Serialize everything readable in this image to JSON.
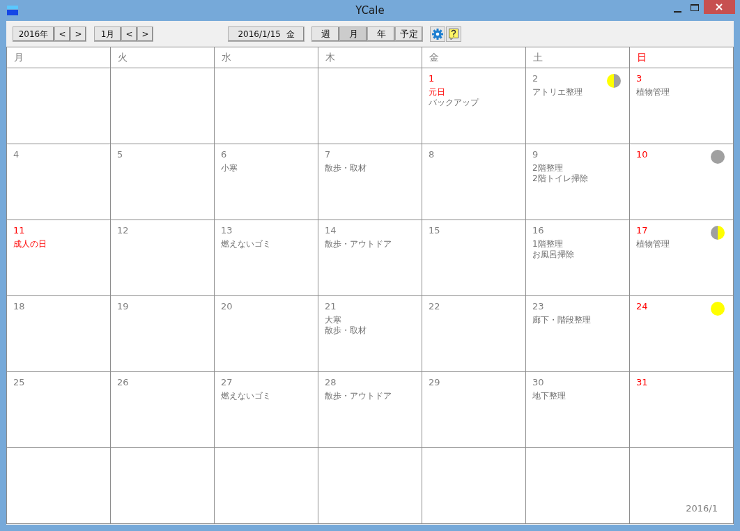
{
  "window": {
    "title": "YCale"
  },
  "toolbar": {
    "year": {
      "label": "2016年",
      "prev": "<",
      "next": ">"
    },
    "month": {
      "label": "1月",
      "prev": "<",
      "next": ">"
    },
    "today": "2016/1/15  金",
    "views": [
      {
        "label": "週",
        "selected": false
      },
      {
        "label": "月",
        "selected": true
      },
      {
        "label": "年",
        "selected": false
      },
      {
        "label": "予定",
        "selected": false
      }
    ]
  },
  "weekdays": [
    {
      "label": "月",
      "holiday": false
    },
    {
      "label": "火",
      "holiday": false
    },
    {
      "label": "水",
      "holiday": false
    },
    {
      "label": "木",
      "holiday": false
    },
    {
      "label": "金",
      "holiday": false
    },
    {
      "label": "土",
      "holiday": false
    },
    {
      "label": "日",
      "holiday": true
    }
  ],
  "cells": [
    {},
    {},
    {},
    {},
    {
      "day": "1",
      "holiday": true,
      "events": [
        {
          "text": "元日",
          "holiday": true
        },
        {
          "text": "バックアップ",
          "holiday": false
        }
      ]
    },
    {
      "day": "2",
      "holiday": false,
      "moon": {
        "kind": "last_quarter"
      },
      "events": [
        {
          "text": "アトリエ整理",
          "holiday": false
        }
      ]
    },
    {
      "day": "3",
      "holiday": true,
      "events": [
        {
          "text": "植物管理",
          "holiday": false
        }
      ]
    },
    {
      "day": "4",
      "holiday": false
    },
    {
      "day": "5",
      "holiday": false
    },
    {
      "day": "6",
      "holiday": false,
      "events": [
        {
          "text": "小寒",
          "holiday": false
        }
      ]
    },
    {
      "day": "7",
      "holiday": false,
      "events": [
        {
          "text": "散歩・取材",
          "holiday": false
        }
      ]
    },
    {
      "day": "8",
      "holiday": false
    },
    {
      "day": "9",
      "holiday": false,
      "events": [
        {
          "text": "2階整理",
          "holiday": false
        },
        {
          "text": "2階トイレ掃除",
          "holiday": false
        }
      ]
    },
    {
      "day": "10",
      "holiday": true,
      "moon": {
        "kind": "new_moon"
      }
    },
    {
      "day": "11",
      "holiday": true,
      "events": [
        {
          "text": "成人の日",
          "holiday": true
        }
      ]
    },
    {
      "day": "12",
      "holiday": false
    },
    {
      "day": "13",
      "holiday": false,
      "events": [
        {
          "text": "燃えないゴミ",
          "holiday": false
        }
      ]
    },
    {
      "day": "14",
      "holiday": false,
      "events": [
        {
          "text": "散歩・アウトドア",
          "holiday": false
        }
      ]
    },
    {
      "day": "15",
      "holiday": false
    },
    {
      "day": "16",
      "holiday": false,
      "events": [
        {
          "text": "1階整理",
          "holiday": false
        },
        {
          "text": "お風呂掃除",
          "holiday": false
        }
      ]
    },
    {
      "day": "17",
      "holiday": true,
      "moon": {
        "kind": "first_quarter"
      },
      "events": [
        {
          "text": "植物管理",
          "holiday": false
        }
      ]
    },
    {
      "day": "18",
      "holiday": false
    },
    {
      "day": "19",
      "holiday": false
    },
    {
      "day": "20",
      "holiday": false
    },
    {
      "day": "21",
      "holiday": false,
      "events": [
        {
          "text": "大寒",
          "holiday": false
        },
        {
          "text": "散歩・取材",
          "holiday": false
        }
      ]
    },
    {
      "day": "22",
      "holiday": false
    },
    {
      "day": "23",
      "holiday": false,
      "events": [
        {
          "text": "廊下・階段整理",
          "holiday": false
        }
      ]
    },
    {
      "day": "24",
      "holiday": true,
      "moon": {
        "kind": "full_moon"
      }
    },
    {
      "day": "25",
      "holiday": false
    },
    {
      "day": "26",
      "holiday": false
    },
    {
      "day": "27",
      "holiday": false,
      "events": [
        {
          "text": "燃えないゴミ",
          "holiday": false
        }
      ]
    },
    {
      "day": "28",
      "holiday": false,
      "events": [
        {
          "text": "散歩・アウトドア",
          "holiday": false
        }
      ]
    },
    {
      "day": "29",
      "holiday": false
    },
    {
      "day": "30",
      "holiday": false,
      "events": [
        {
          "text": "地下整理",
          "holiday": false
        }
      ]
    },
    {
      "day": "31",
      "holiday": true
    },
    {},
    {},
    {},
    {},
    {},
    {},
    {}
  ],
  "month_label": "2016/1"
}
